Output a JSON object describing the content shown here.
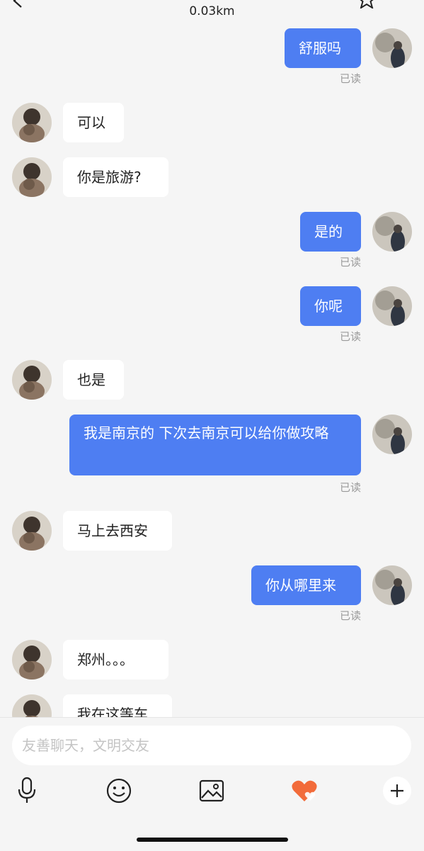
{
  "header": {
    "distance": "0.03km",
    "back_icon": "chevron-left-icon",
    "right_icon": "star-icon"
  },
  "colors": {
    "outgoing_bubble": "#4e7ef2",
    "incoming_bubble": "#ffffff",
    "background": "#f5f5f5",
    "heart_accent": "#f26b3a"
  },
  "messages": [
    {
      "direction": "out",
      "text": "舒服吗",
      "status": "已读"
    },
    {
      "direction": "in",
      "text": "可以"
    },
    {
      "direction": "in",
      "text": "你是旅游?"
    },
    {
      "direction": "out",
      "text": "是的",
      "status": "已读"
    },
    {
      "direction": "out",
      "text": "你呢",
      "status": "已读"
    },
    {
      "direction": "in",
      "text": "也是"
    },
    {
      "direction": "out",
      "text": "我是南京的 下次去南京可以给你做攻略",
      "status": "已读"
    },
    {
      "direction": "in",
      "text": "马上去西安"
    },
    {
      "direction": "out",
      "text": "你从哪里来",
      "status": "已读"
    },
    {
      "direction": "in",
      "text": "郑州。。。"
    },
    {
      "direction": "in",
      "text": "我在这等车"
    }
  ],
  "input": {
    "placeholder": "友善聊天，文明交友",
    "value": ""
  },
  "toolbar": {
    "icons": [
      "microphone-icon",
      "emoji-icon",
      "image-icon",
      "heart-gift-icon",
      "plus-icon"
    ]
  }
}
